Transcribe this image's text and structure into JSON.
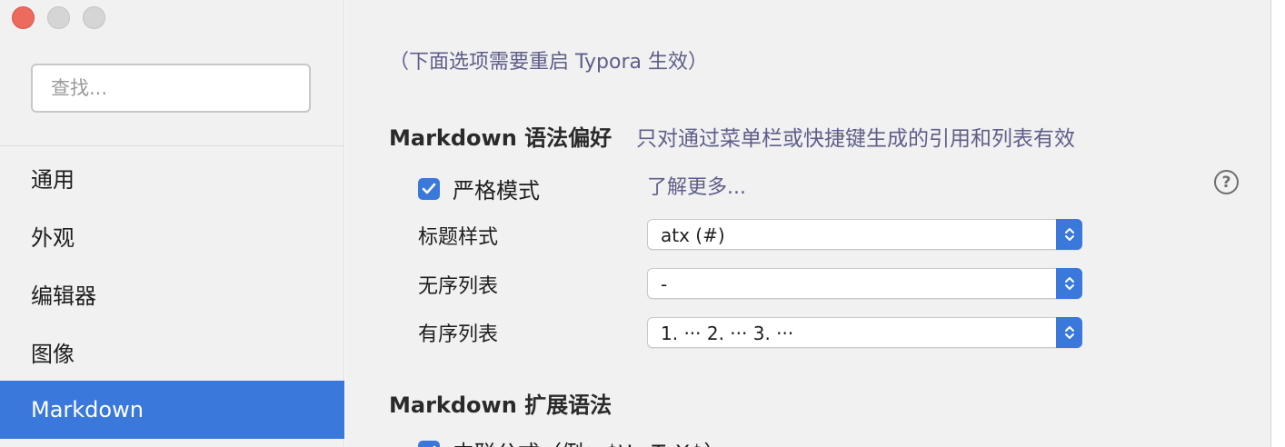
{
  "sidebar": {
    "search_placeholder": "查找...",
    "items": [
      {
        "label": "通用"
      },
      {
        "label": "外观"
      },
      {
        "label": "编辑器"
      },
      {
        "label": "图像"
      },
      {
        "label": "Markdown"
      }
    ],
    "active_item": "Markdown"
  },
  "main": {
    "note": "（下面选项需要重启 Typora 生效）",
    "syntax_section": {
      "title": "Markdown 语法偏好",
      "hint": "只对通过菜单栏或快捷键生成的引用和列表有效",
      "strict_mode": {
        "label": "严格模式",
        "checked": true
      },
      "learn_more": "了解更多...",
      "help_icon": "question-circle-icon",
      "heading_style": {
        "label": "标题样式",
        "value": "atx (#)"
      },
      "unordered_list": {
        "label": "无序列表",
        "value": "-"
      },
      "ordered_list": {
        "label": "有序列表",
        "value": "1. ··· 2. ··· 3. ···"
      }
    },
    "extended_section": {
      "title": "Markdown 扩展语法",
      "inline_math": {
        "label": "内联公式（例：$\\LaTeX$）",
        "checked": true
      }
    }
  },
  "colors": {
    "accent": "#3a78dc",
    "close_button": "#ee6a5f",
    "hint_text": "#5e5e8a"
  }
}
